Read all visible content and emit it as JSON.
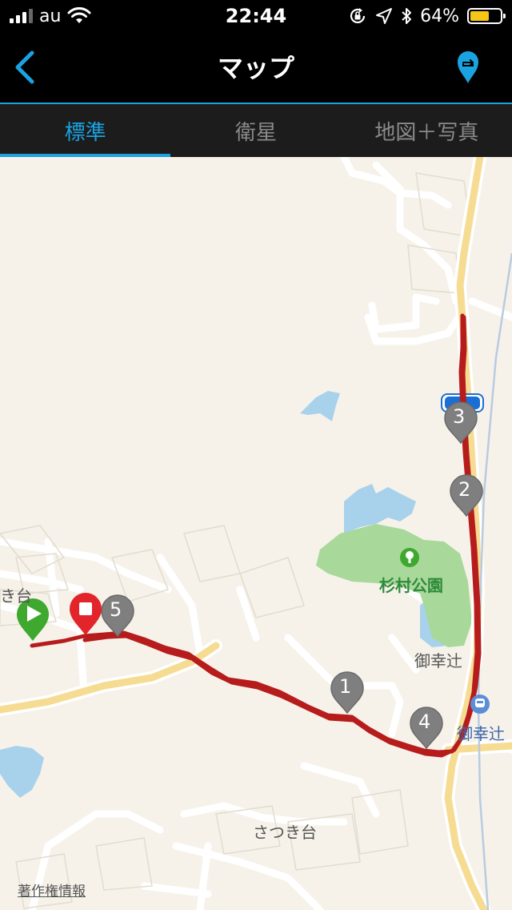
{
  "status_bar": {
    "carrier": "au",
    "time": "22:44",
    "battery": "64%",
    "battery_level": 0.64,
    "signal_bars": 3,
    "icons": [
      "signal-icon",
      "wifi-icon",
      "rotation-lock-icon",
      "location-arrow-icon",
      "bluetooth-icon",
      "battery-icon"
    ]
  },
  "nav": {
    "title": "マップ",
    "back_icon": "chevron-left-icon",
    "share_icon": "share-pin-icon",
    "accent": "#1aa3e0"
  },
  "tabs": [
    {
      "label": "標準",
      "active": true
    },
    {
      "label": "衛星",
      "active": false
    },
    {
      "label": "地図＋写真",
      "active": false
    }
  ],
  "map": {
    "labels": {
      "park": "杉村公園",
      "area_misaki_1": "御幸辻",
      "area_misaki_2": "御幸辻",
      "satsukidai": "さつき台",
      "partial_left": "き台",
      "copyright": "著作権情報"
    },
    "route_color": "#b71c1c",
    "markers": {
      "start_icon": "play-icon",
      "stop_icon": "stop-icon",
      "laps": [
        "1",
        "2",
        "3",
        "4",
        "5"
      ]
    }
  }
}
